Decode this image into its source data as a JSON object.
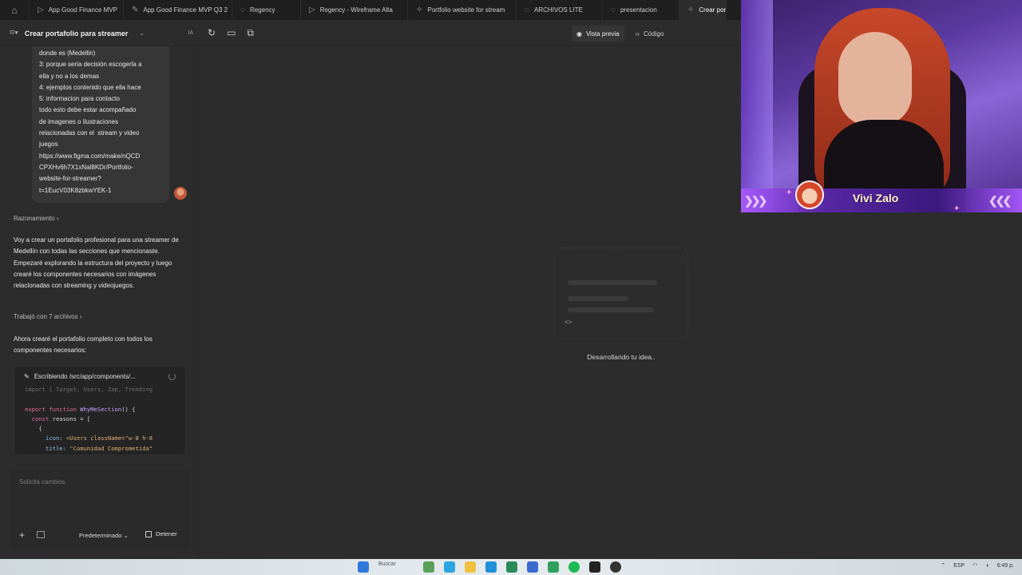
{
  "browser": {
    "tabs": [
      {
        "label": "App Good Finance MVP",
        "icon": "play-icon"
      },
      {
        "label": "App Good Finance MVP Q3 2",
        "icon": "figma-icon"
      },
      {
        "label": "Regency",
        "icon": "figma-icon"
      },
      {
        "label": "Regency - Wireframe Alta",
        "icon": "play-icon"
      },
      {
        "label": "Portfolio website for stream",
        "icon": "figma-make-icon"
      },
      {
        "label": "ARCHIVOS LITE",
        "icon": "figma-icon"
      },
      {
        "label": "presentacion",
        "icon": "figma-icon"
      },
      {
        "label": "Crear por",
        "icon": "figma-make-icon"
      }
    ]
  },
  "toolbar": {
    "project_title": "Crear portafolio para streamer",
    "ia_label": "IA",
    "preview_label": "Vista previa",
    "code_label": "Código"
  },
  "chat": {
    "user_message_lines": [
      "donde es (Medellin)",
      "3: porque seria decisión escogerla a",
      "ella y no a los demas",
      "4: ejemplos contenido que ella hace",
      "5: informacion para contacto",
      "todo esto debe estar acompañado",
      "de imagenes o ilustraciones",
      "relacionadas con el  stream y video",
      "juegos",
      "https://www.figma.com/make/nQCD",
      "CPXHv6h7X1xNal8KDr/Portfolio-",
      "website-for-streamer?",
      "t=1EucV03K8zbkwYEK-1"
    ],
    "reasoning_label": "Razonamiento",
    "assistant_paragraph_1": "Voy a crear un portafolio profesional para una streamer de Medellín con todas las secciones que mencionaste. Empezaré explorando la estructura del proyecto y luego crearé los componentes necesarios con imágenes relacionadas con streaming y videojuegos.",
    "worked_label": "Trabajó con 7 archivos",
    "assistant_paragraph_2": "Ahora crearé el portafolio completo con todos los componentes necesarios:",
    "writing_label": "Escribiendo /src/app/components/...",
    "code": {
      "line1": "import { Target, Users, Zap, Trending",
      "line2_kw": "export function",
      "line2_fn": "WhyMeSection",
      "line2_rest": "() {",
      "line3_kw": "const",
      "line3_rest": "reasons = [",
      "line4": "{",
      "line5_prop": "icon:",
      "line5_rest": "<Users className=\"w-8 h-8",
      "line6_prop": "title:",
      "line6_rest": "\"Comunidad Comprometida\""
    }
  },
  "composer": {
    "placeholder": "Solicita cambios",
    "model_label": "Predeterminado",
    "stop_label": "Detener"
  },
  "preview": {
    "status_text": "Desarrollando tu idea..",
    "code_glyph": "<>"
  },
  "webcam": {
    "streamer_name": "Vivi Zalo"
  },
  "taskbar": {
    "lang": "ESP",
    "search_text": "Buscar",
    "time": "6:49 p."
  }
}
